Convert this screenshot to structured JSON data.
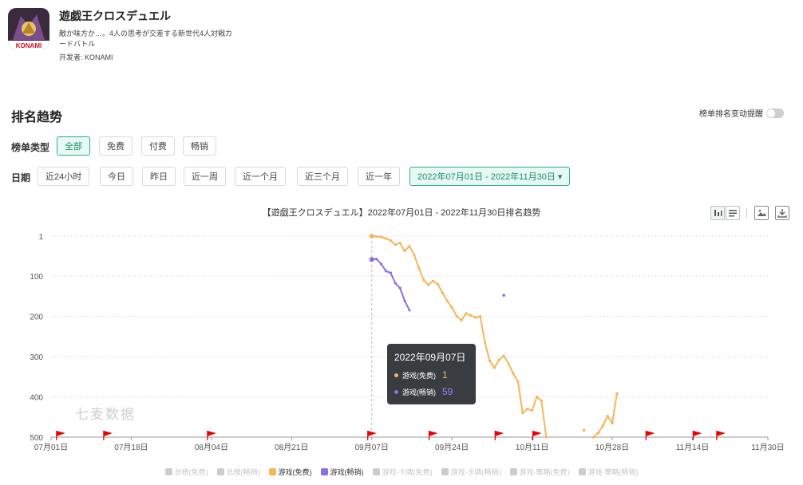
{
  "app": {
    "name": "遊戯王クロスデュエル",
    "description": "敵か味方か…。4人の思考が交差する新世代4人対戦カードバトル",
    "developer": "开发者: KONAMI",
    "icon_text": "KONAMI"
  },
  "section": {
    "title": "排名趋势",
    "alert_label": "榜单排名变动提醒"
  },
  "chart_type_row": {
    "label": "榜单类型",
    "options": [
      "全部",
      "免费",
      "付费",
      "畅销"
    ],
    "active": "全部"
  },
  "date_row": {
    "label": "日期",
    "options": [
      "近24小时",
      "今日",
      "昨日",
      "近一周",
      "近一个月",
      "近三个月",
      "近一年"
    ],
    "range": "2022年07月01日 - 2022年11月30日 ▾"
  },
  "tooltip": {
    "date": "2022年09月07日",
    "rows": [
      {
        "name": "游戏(免费)",
        "value": "1",
        "color": "#f5b55b"
      },
      {
        "name": "游戏(畅销)",
        "value": "59",
        "color": "#8474e8"
      }
    ]
  },
  "watermark": "七麦数据",
  "chart_data": {
    "type": "line",
    "title": "【遊戯王クロスデュエル】2022年07月01日 - 2022年11月30日排名趋势",
    "y_inverted": true,
    "ylim": [
      1,
      500
    ],
    "y_ticks": [
      "1",
      "100",
      "200",
      "300",
      "400",
      "500"
    ],
    "x_range": [
      "2022-07-01",
      "2022-11-30"
    ],
    "x_ticks": [
      "07月01日",
      "07月18日",
      "08月04日",
      "08月21日",
      "09月07日",
      "09月24日",
      "10月11日",
      "10月28日",
      "11月14日",
      "11月30日"
    ],
    "grid": true,
    "legend_position": "bottom",
    "legend": [
      {
        "name": "总榜(免费)",
        "color": "#cccccc",
        "active": false
      },
      {
        "name": "总榜(畅销)",
        "color": "#cccccc",
        "active": false
      },
      {
        "name": "游戏(免费)",
        "color": "#f5b55b",
        "active": true
      },
      {
        "name": "游戏(畅销)",
        "color": "#8474e8",
        "active": true
      },
      {
        "name": "游戏-卡牌(免费)",
        "color": "#cccccc",
        "active": false
      },
      {
        "name": "游戏-卡牌(畅销)",
        "color": "#cccccc",
        "active": false
      },
      {
        "name": "游戏-策略(免费)",
        "color": "#cccccc",
        "active": false
      },
      {
        "name": "游戏-策略(畅销)",
        "color": "#cccccc",
        "active": false
      }
    ],
    "series": [
      {
        "name": "游戏(免费)",
        "color": "#f5b55b",
        "points": [
          [
            "2022-09-07",
            1
          ],
          [
            "2022-09-08",
            2
          ],
          [
            "2022-09-09",
            3
          ],
          [
            "2022-09-10",
            7
          ],
          [
            "2022-09-11",
            12
          ],
          [
            "2022-09-12",
            22
          ],
          [
            "2022-09-13",
            18
          ],
          [
            "2022-09-14",
            38
          ],
          [
            "2022-09-15",
            26
          ],
          [
            "2022-09-16",
            48
          ],
          [
            "2022-09-17",
            80
          ],
          [
            "2022-09-18",
            110
          ],
          [
            "2022-09-19",
            122
          ],
          [
            "2022-09-20",
            112
          ],
          [
            "2022-09-21",
            120
          ],
          [
            "2022-09-22",
            142
          ],
          [
            "2022-09-23",
            162
          ],
          [
            "2022-09-24",
            178
          ],
          [
            "2022-09-25",
            200
          ],
          [
            "2022-09-26",
            210
          ],
          [
            "2022-09-27",
            193
          ],
          [
            "2022-09-28",
            198
          ],
          [
            "2022-09-29",
            203
          ],
          [
            "2022-09-30",
            200
          ],
          [
            "2022-10-01",
            265
          ],
          [
            "2022-10-02",
            310
          ],
          [
            "2022-10-03",
            328
          ],
          [
            "2022-10-04",
            308
          ],
          [
            "2022-10-05",
            298
          ],
          [
            "2022-10-06",
            318
          ],
          [
            "2022-10-07",
            342
          ],
          [
            "2022-10-08",
            362
          ],
          [
            "2022-10-09",
            440
          ],
          [
            "2022-10-10",
            430
          ],
          [
            "2022-10-11",
            434
          ],
          [
            "2022-10-12",
            400
          ],
          [
            "2022-10-13",
            410
          ],
          [
            "2022-10-14",
            500
          ]
        ],
        "extra_points": [
          [
            "2022-10-22",
            483
          ],
          [
            "2022-10-24",
            500
          ],
          [
            "2022-10-25",
            490
          ],
          [
            "2022-10-26",
            472
          ],
          [
            "2022-10-27",
            448
          ],
          [
            "2022-10-28",
            465
          ],
          [
            "2022-10-29",
            392
          ]
        ]
      },
      {
        "name": "游戏(畅销)",
        "color": "#8474e8",
        "points": [
          [
            "2022-09-07",
            59
          ],
          [
            "2022-09-08",
            58
          ],
          [
            "2022-09-09",
            70
          ],
          [
            "2022-09-10",
            88
          ],
          [
            "2022-09-11",
            92
          ],
          [
            "2022-09-12",
            118
          ],
          [
            "2022-09-13",
            130
          ],
          [
            "2022-09-14",
            162
          ],
          [
            "2022-09-15",
            185
          ]
        ],
        "extra_points": [
          [
            "2022-10-05",
            148
          ]
        ]
      }
    ],
    "event_markers": [
      "2022-07-03",
      "2022-07-13",
      "2022-08-04",
      "2022-09-07",
      "2022-09-20",
      "2022-10-04",
      "2022-10-12",
      "2022-11-05",
      "2022-11-15",
      "2022-11-20"
    ]
  }
}
